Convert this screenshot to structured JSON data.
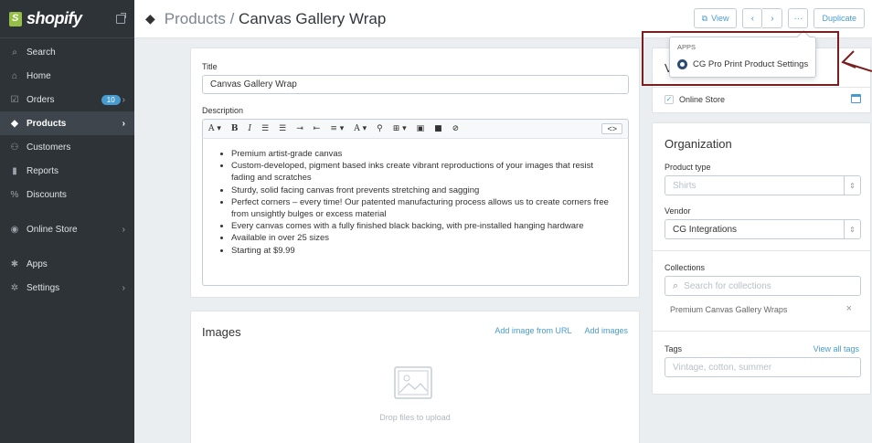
{
  "sidebar": {
    "brand": "shopify",
    "items": [
      {
        "label": "Search",
        "icon": "search-icon",
        "glyph": "⌕"
      },
      {
        "label": "Home",
        "icon": "home-icon",
        "glyph": "⌂"
      },
      {
        "label": "Orders",
        "icon": "orders-icon",
        "glyph": "☑",
        "badge": "10"
      },
      {
        "label": "Products",
        "icon": "tag-icon",
        "glyph": "◆"
      },
      {
        "label": "Customers",
        "icon": "customers-icon",
        "glyph": "⚇"
      },
      {
        "label": "Reports",
        "icon": "reports-icon",
        "glyph": "▮"
      },
      {
        "label": "Discounts",
        "icon": "discounts-icon",
        "glyph": "%"
      },
      {
        "label": "Online Store",
        "icon": "online-store-icon",
        "glyph": "◉"
      },
      {
        "label": "Apps",
        "icon": "apps-icon",
        "glyph": "✱"
      },
      {
        "label": "Settings",
        "icon": "gear-icon",
        "glyph": "✲"
      }
    ]
  },
  "header": {
    "crumb": "Products",
    "separator": " / ",
    "title": "Canvas Gallery Wrap",
    "view_label": "View",
    "prev_glyph": "‹",
    "next_glyph": "›",
    "more_glyph": "···",
    "duplicate_label": "Duplicate"
  },
  "dropdown": {
    "section": "APPS",
    "item": "CG Pro Print Product Settings"
  },
  "product": {
    "title_label": "Title",
    "title_value": "Canvas Gallery Wrap",
    "description_label": "Description",
    "toolbar": {
      "font": "A ▾",
      "bold": "B",
      "italic": "I",
      "ul": "☰",
      "ol": "☰",
      "indent": "⇥",
      "outdent": "⇤",
      "align": "≡ ▾",
      "color": "A ▾",
      "link": "⚲",
      "table": "⊞ ▾",
      "image": "▣",
      "video": "■",
      "clear": "⊘",
      "html": "<>"
    },
    "description_bullets": [
      "Premium artist-grade canvas",
      "Custom-developed, pigment based inks create vibrant reproductions of your images that resist fading and scratches",
      "Sturdy, solid facing canvas front prevents stretching and sagging",
      "Perfect corners – every time! Our patented manufacturing process allows us to create corners free from unsightly bulges or excess material",
      "Every canvas comes with a fully finished black backing, with pre-installed hanging hardware",
      "Available in over 25 sizes",
      "Starting at $9.99"
    ]
  },
  "images": {
    "title": "Images",
    "add_from_url": "Add image from URL",
    "add_images": "Add images",
    "drop_text": "Drop files to upload"
  },
  "visibility": {
    "title": "V",
    "online_store": "Online Store"
  },
  "organization": {
    "title": "Organization",
    "product_type_label": "Product type",
    "product_type_placeholder": "Shirts",
    "vendor_label": "Vendor",
    "vendor_value": "CG Integrations",
    "collections_label": "Collections",
    "collections_placeholder": "Search for collections",
    "collection_item": "Premium Canvas Gallery Wraps",
    "remove_glyph": "×",
    "tags_label": "Tags",
    "view_all_tags": "View all tags",
    "tags_placeholder": "Vintage, cotton, summer"
  },
  "colors": {
    "sidebar_bg": "#2e3338",
    "accent": "#479ccf",
    "highlight": "#7a1e1e",
    "brand_green": "#95bf47"
  }
}
